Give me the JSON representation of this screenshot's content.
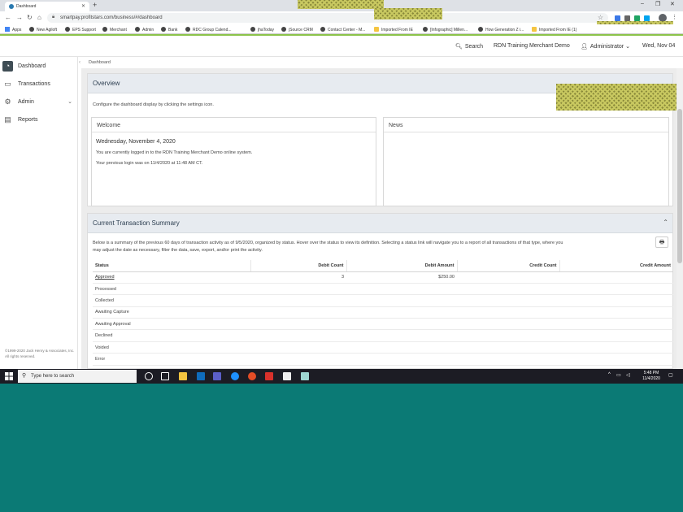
{
  "browser": {
    "tab_title": "Dashboard",
    "new_tab": "+",
    "url": "smartpay.profitstars.com/business/#/dashboard",
    "window_controls": [
      "–",
      "❐",
      "✕"
    ]
  },
  "bookmarks": [
    {
      "label": "Apps",
      "kind": "grid"
    },
    {
      "label": "New Agiloft",
      "kind": "site"
    },
    {
      "label": "EPS Support",
      "kind": "site"
    },
    {
      "label": "Merchant",
      "kind": "site"
    },
    {
      "label": "Admin",
      "kind": "site"
    },
    {
      "label": "Bank",
      "kind": "site"
    },
    {
      "label": "RDC Group Calend...",
      "kind": "site"
    },
    {
      "label": "jhaToday",
      "kind": "site"
    },
    {
      "label": "jSource CRM",
      "kind": "site"
    },
    {
      "label": "Contact Center - M...",
      "kind": "site"
    },
    {
      "label": "Imported From IE",
      "kind": "folder"
    },
    {
      "label": "[Infographic] Millen...",
      "kind": "site"
    },
    {
      "label": "How Generation Z i...",
      "kind": "site"
    },
    {
      "label": "Imported From IE (1)",
      "kind": "folder"
    }
  ],
  "header": {
    "search_label": "Search",
    "merchant_name": "RDN Training Merchant Demo",
    "user_label": "Administrator",
    "date_label": "Wed, Nov 04"
  },
  "sidebar": {
    "items": [
      {
        "label": "Dashboard",
        "icon": "dashboard-icon"
      },
      {
        "label": "Transactions",
        "icon": "transactions-icon"
      },
      {
        "label": "Admin",
        "icon": "admin-gear-icon"
      },
      {
        "label": "Reports",
        "icon": "reports-icon"
      }
    ],
    "copyright": "©1999-2020 Jack Henry & Associates, Inc. All rights reserved."
  },
  "breadcrumb": "Dashboard",
  "overview": {
    "title": "Overview",
    "hint": "Configure the dashboard display by clicking the settings icon.",
    "welcome": {
      "title": "Welcome",
      "date": "Wednesday, November 4, 2020",
      "logged_in": "You are currently logged in to the RDN Training Merchant Demo online system.",
      "previous_login": "Your previous login was on 11/4/2020 at 11:48 AM CT."
    },
    "news": {
      "title": "News"
    }
  },
  "summary": {
    "title": "Current Transaction Summary",
    "description_line1": "Below is a summary of the previous 60 days of transaction activity as of 9/5/2020, organized by status. Hover over the status to view its definition. Selecting a status link will navigate you to a report of all transactions of that type, where you",
    "description_line2": "may adjust the date as necessary, filter the data, save, export, and/or print the activity.",
    "columns": [
      "Status",
      "Debit Count",
      "Debit Amount",
      "Credit Count",
      "Credit Amount"
    ],
    "rows": [
      {
        "status": "Approved",
        "debit_count": "3",
        "debit_amount": "$250.00",
        "credit_count": "",
        "credit_amount": ""
      },
      {
        "status": "Processed",
        "debit_count": "",
        "debit_amount": "",
        "credit_count": "",
        "credit_amount": ""
      },
      {
        "status": "Collected",
        "debit_count": "",
        "debit_amount": "",
        "credit_count": "",
        "credit_amount": ""
      },
      {
        "status": "Awaiting Capture",
        "debit_count": "",
        "debit_amount": "",
        "credit_count": "",
        "credit_amount": ""
      },
      {
        "status": "Awaiting Approval",
        "debit_count": "",
        "debit_amount": "",
        "credit_count": "",
        "credit_amount": ""
      },
      {
        "status": "Declined",
        "debit_count": "",
        "debit_amount": "",
        "credit_count": "",
        "credit_amount": ""
      },
      {
        "status": "Voided",
        "debit_count": "",
        "debit_amount": "",
        "credit_count": "",
        "credit_amount": ""
      },
      {
        "status": "Error",
        "debit_count": "",
        "debit_amount": "",
        "credit_count": "",
        "credit_amount": ""
      }
    ]
  },
  "taskbar": {
    "search_placeholder": "Type here to search",
    "time": "5:48 PM",
    "date": "11/4/2020"
  },
  "colors": {
    "accent_green": "#8bc34a",
    "desktop_teal": "#0b7a75",
    "sidebar_active": "#3f4d55"
  }
}
